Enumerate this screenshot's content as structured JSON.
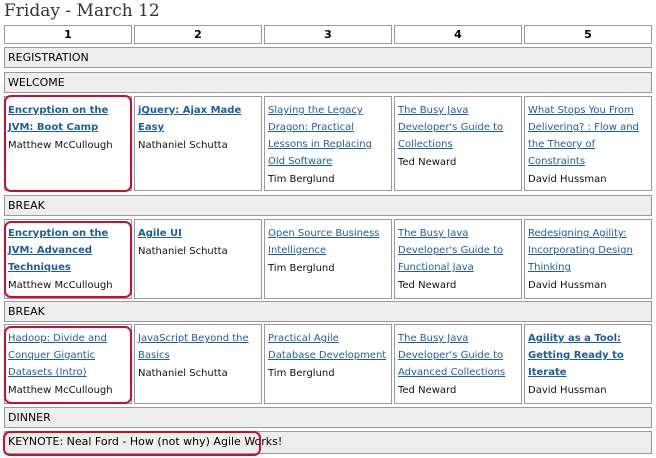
{
  "title": "Friday - March 12",
  "columns": [
    "1",
    "2",
    "3",
    "4",
    "5"
  ],
  "rows": {
    "registration": "REGISTRATION",
    "welcome": "WELCOME",
    "break1": "BREAK",
    "break2": "BREAK",
    "dinner": "DINNER",
    "keynote": "KEYNOTE: Neal Ford - How (not why) Agile Works!"
  },
  "slot1": [
    {
      "title": "Encryption on the JVM: Boot Camp",
      "speaker": "Matthew McCullough",
      "bold": true
    },
    {
      "title": "jQuery: Ajax Made Easy",
      "speaker": "Nathaniel Schutta",
      "bold": true
    },
    {
      "title": "Slaying the Legacy Dragon: Practical Lessons in Replacing Old Software",
      "speaker": "Tim Berglund",
      "bold": false
    },
    {
      "title": "The Busy Java Developer's Guide to Collections",
      "speaker": "Ted Neward",
      "bold": false
    },
    {
      "title": "What Stops You From Delivering? : Flow and the Theory of Constraints",
      "speaker": "David Hussman",
      "bold": false
    }
  ],
  "slot2": [
    {
      "title": "Encryption on the JVM: Advanced Techniques",
      "speaker": "Matthew McCullough",
      "bold": true
    },
    {
      "title": "Agile UI",
      "speaker": "Nathaniel Schutta",
      "bold": true
    },
    {
      "title": "Open Source Business Intelligence",
      "speaker": "Tim Berglund",
      "bold": false
    },
    {
      "title": "The Busy Java Developer's Guide to Functional Java",
      "speaker": "Ted Neward",
      "bold": false
    },
    {
      "title": "Redesigning Agility: Incorporating Design Thinking",
      "speaker": "David Hussman",
      "bold": false
    }
  ],
  "slot3": [
    {
      "title": "Hadoop: Divide and Conquer Gigantic Datasets (Intro)",
      "speaker": "Matthew McCullough",
      "bold": false
    },
    {
      "title": "JavaScript Beyond the Basics",
      "speaker": "Nathaniel Schutta",
      "bold": false
    },
    {
      "title": "Practical Agile Database Development",
      "speaker": "Tim Berglund",
      "bold": false
    },
    {
      "title": "The Busy Java Developer's Guide to Advanced Collections",
      "speaker": "Ted Neward",
      "bold": false
    },
    {
      "title": "Agility as a Tool: Getting Ready to Iterate",
      "speaker": "David Hussman",
      "bold": true
    }
  ],
  "colors": {
    "link": "#1d5f9c",
    "highlight": "#c8102e",
    "row_bg": "#eeeeee",
    "border": "#9a9a9a"
  }
}
